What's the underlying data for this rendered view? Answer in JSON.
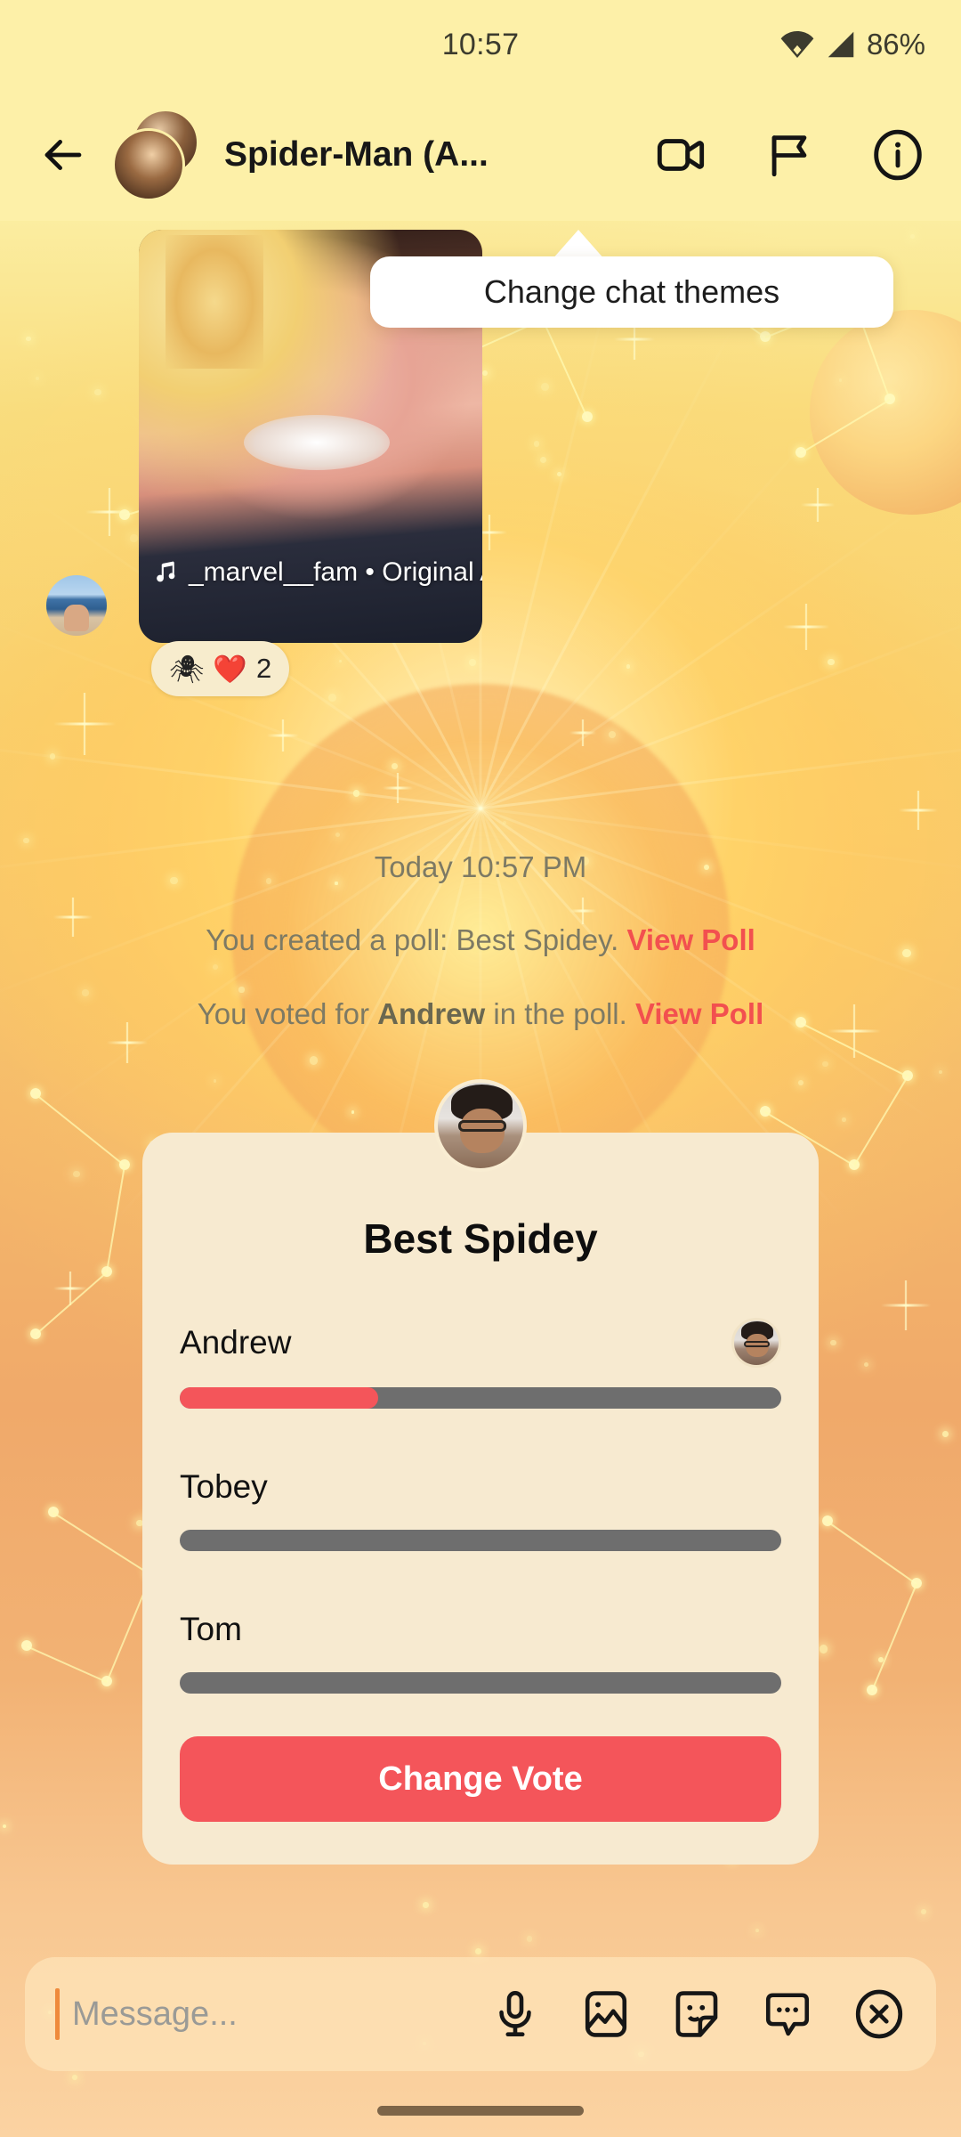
{
  "status_bar": {
    "time": "10:57",
    "battery": "86%",
    "wifi_icon": "wifi-icon",
    "signal_icon": "cellular-signal-icon"
  },
  "app_bar": {
    "back_icon": "back-arrow-icon",
    "title": "Spider-Man (A...",
    "video_call_icon": "video-call-icon",
    "flag_icon": "flag-icon",
    "info_icon": "info-circle-icon"
  },
  "tooltip": {
    "text": "Change chat themes"
  },
  "message": {
    "sender_avatar": "beach-photo-avatar",
    "music_icon": "music-note-icon",
    "caption": "_marvel__fam • Original A",
    "reaction": {
      "emoji_1": "🕷",
      "emoji_2": "❤️",
      "count": "2"
    }
  },
  "system_messages": [
    {
      "text": "Today 10:57 PM",
      "type": "timestamp"
    },
    {
      "prefix": "You created a poll: Best Spidey.",
      "link": "View Poll"
    },
    {
      "prefix_a": "You voted for ",
      "bold": "Andrew",
      "prefix_b": " in the poll.",
      "link": "View Poll"
    }
  ],
  "poll": {
    "avatar": "creator-avatar",
    "title": "Best Spidey",
    "options": [
      {
        "label": "Andrew",
        "percent": 33,
        "voted": true,
        "voter_avatar": "voter-avatar"
      },
      {
        "label": "Tobey",
        "percent": 0,
        "voted": false
      },
      {
        "label": "Tom",
        "percent": 0,
        "voted": false
      }
    ],
    "button_label": "Change Vote"
  },
  "composer": {
    "placeholder": "Message...",
    "mic_icon": "microphone-icon",
    "gallery_icon": "image-gallery-icon",
    "sticker_icon": "sticker-icon",
    "gif_icon": "gif-chat-bubble-icon",
    "close_icon": "close-circle-icon"
  },
  "colors": {
    "accent_red": "#f4555a",
    "link_red": "#f2504f",
    "bar_track": "#6e6e6e",
    "card_bg": "#f7ead0",
    "header_bg": "#fdf0a8",
    "tooltip_bg": "#ffffff"
  }
}
